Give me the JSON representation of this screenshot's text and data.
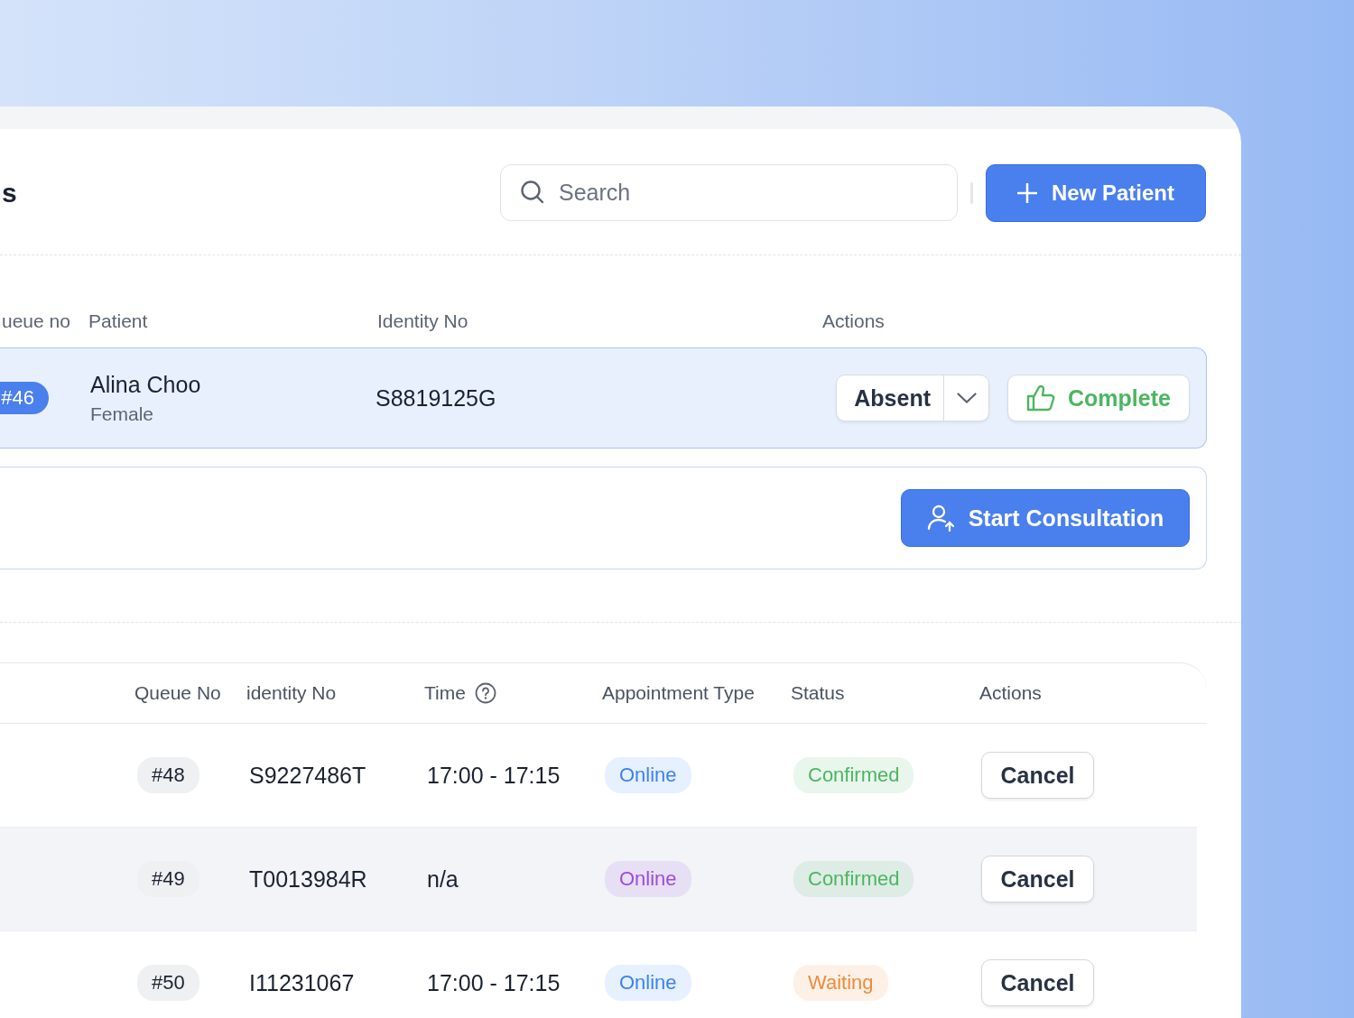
{
  "title_fragment": "s",
  "search": {
    "placeholder": "Search"
  },
  "new_patient_button": "New Patient",
  "current": {
    "columns": [
      "ueue no",
      "Patient",
      "Identity No",
      "Actions"
    ],
    "patient": {
      "queue_no": "#46",
      "name": "Alina Choo",
      "gender": "Female",
      "identity_no": "S8819125G",
      "absent_button": "Absent",
      "complete_button": "Complete"
    },
    "start_button": "Start Consultation"
  },
  "table": {
    "columns": [
      "Queue No",
      "identity No",
      "Time",
      "Appointment Type",
      "Status",
      "Actions"
    ],
    "rows": [
      {
        "queue_no": "#48",
        "identity_no": "S9227486T",
        "time": "17:00 - 17:15",
        "type": {
          "label": "Online",
          "color": "#3b82f6"
        },
        "status": {
          "label": "Confirmed",
          "color": "#4cb660"
        },
        "action": "Cancel",
        "highlighted": false
      },
      {
        "queue_no": "#49",
        "identity_no": "T0013984R",
        "time": "n/a",
        "type": {
          "label": "Online",
          "color": "#9b4de0"
        },
        "status": {
          "label": "Confirmed",
          "color": "#4cb660"
        },
        "action": "Cancel",
        "highlighted": true
      },
      {
        "queue_no": "#50",
        "identity_no": "I11231067",
        "time": "17:00 - 17:15",
        "type": {
          "label": "Online",
          "color": "#3b82f6"
        },
        "status": {
          "label": "Waiting",
          "color": "#f08a3c"
        },
        "action": "Cancel",
        "highlighted": false
      }
    ]
  }
}
